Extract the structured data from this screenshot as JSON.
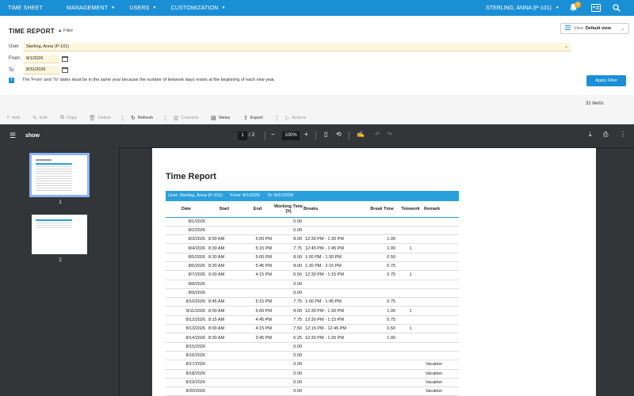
{
  "nav": {
    "app": "TIME SHEET",
    "management": "MANAGEMENT",
    "users": "USERS",
    "customization": "CUSTOMIZATION",
    "current_user": "STERLING, ANNA (P-101)",
    "notif_count": "4"
  },
  "header": {
    "title": "TIME REPORT",
    "filter": "Filter",
    "view_label": "View",
    "view_value": "Default view"
  },
  "filters": {
    "user_label": "User",
    "user_value": "Sterling, Anna (P-101)",
    "from_label": "From",
    "from_value": "8/1/2026",
    "to_label": "To",
    "to_value": "8/31/2026",
    "info": "The 'From' and 'To' dates must be in the same year because the number of telework days resets at the beginning of each new year.",
    "apply": "Apply Filter"
  },
  "toolbar": {
    "count": "31 items",
    "add": "Add",
    "edit": "Edit",
    "copy": "Copy",
    "delete": "Delete",
    "refresh": "Refresh",
    "columns": "Columns",
    "views": "Views",
    "export": "Export",
    "actions": "Actions"
  },
  "viewer": {
    "doc": "show",
    "page": "1",
    "total": "/  2",
    "zoom": "100%",
    "thumb1": "1",
    "thumb2": "2"
  },
  "report": {
    "title": "Time Report",
    "banner_user": "User: Sterling, Anna (P-101)",
    "banner_from": "From: 8/1/2026",
    "banner_to": "To: 8/31/2026",
    "headers": [
      "Date",
      "Start",
      "End",
      "Working Time [h]",
      "Breaks",
      "Break Time",
      "Telework",
      "Remark"
    ],
    "rows": [
      [
        "8/1/2026",
        "",
        "",
        "0.00",
        "",
        "",
        "",
        ""
      ],
      [
        "8/2/2026",
        "",
        "",
        "0.00",
        "",
        "",
        "",
        ""
      ],
      [
        "8/3/2026",
        "8:00 AM",
        "5:00 PM",
        "8.00",
        "12:30 PM - 1:30 PM",
        "1.00",
        "",
        ""
      ],
      [
        "8/4/2026",
        "8:30 AM",
        "5:15 PM",
        "7.75",
        "12:45 PM - 1:45 PM",
        "1.00",
        "1",
        ""
      ],
      [
        "8/5/2026",
        "8:30 AM",
        "5:00 PM",
        "8.00",
        "1:00 PM - 1:30 PM",
        "0.50",
        "",
        ""
      ],
      [
        "8/6/2026",
        "8:30 AM",
        "5:45 PM",
        "8.00",
        "1:30 PM - 2:15 PM",
        "0.75",
        "",
        ""
      ],
      [
        "8/7/2026",
        "9:00 AM",
        "4:15 PM",
        "6.50",
        "12:30 PM - 1:15 PM",
        "0.75",
        "1",
        ""
      ],
      [
        "8/8/2026",
        "",
        "",
        "0.00",
        "",
        "",
        "",
        ""
      ],
      [
        "8/9/2026",
        "",
        "",
        "0.00",
        "",
        "",
        "",
        ""
      ],
      [
        "8/10/2026",
        "8:45 AM",
        "5:15 PM",
        "7.75",
        "1:00 PM - 1:45 PM",
        "0.75",
        "",
        ""
      ],
      [
        "8/11/2026",
        "8:00 AM",
        "5:00 PM",
        "8.00",
        "12:30 PM - 1:30 PM",
        "1.00",
        "1",
        ""
      ],
      [
        "8/12/2026",
        "8:15 AM",
        "4:45 PM",
        "7.75",
        "12:30 PM - 1:15 PM",
        "0.75",
        "",
        ""
      ],
      [
        "8/13/2026",
        "8:00 AM",
        "4:15 PM",
        "7.50",
        "12:15 PM - 12:45 PM",
        "0.50",
        "1",
        ""
      ],
      [
        "8/14/2026",
        "8:30 AM",
        "3:45 PM",
        "6.25",
        "12:30 PM - 1:30 PM",
        "1.00",
        "",
        ""
      ],
      [
        "8/15/2026",
        "",
        "",
        "0.00",
        "",
        "",
        "",
        ""
      ],
      [
        "8/16/2026",
        "",
        "",
        "0.00",
        "",
        "",
        "",
        ""
      ],
      [
        "8/17/2026",
        "",
        "",
        "0.00",
        "",
        "",
        "",
        "Vacation"
      ],
      [
        "8/18/2026",
        "",
        "",
        "0.00",
        "",
        "",
        "",
        "Vacation"
      ],
      [
        "8/19/2026",
        "",
        "",
        "0.00",
        "",
        "",
        "",
        "Vacation"
      ],
      [
        "8/20/2026",
        "",
        "",
        "0.00",
        "",
        "",
        "",
        "Vacation"
      ]
    ]
  }
}
